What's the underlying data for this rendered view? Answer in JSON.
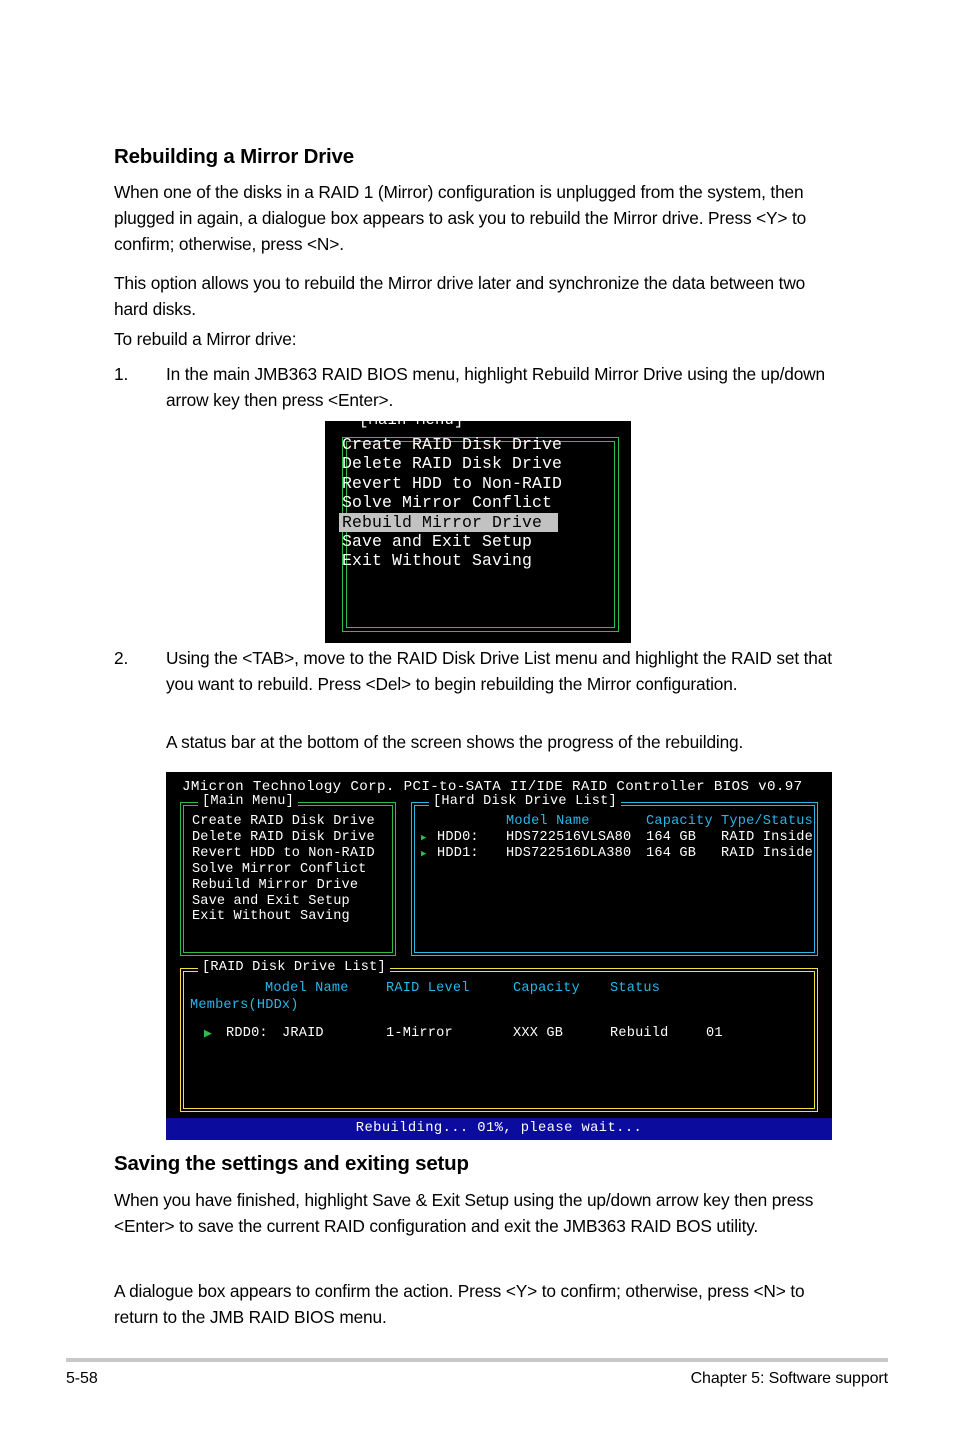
{
  "sections": {
    "heading1": "Rebuilding a Mirror Drive",
    "para1": "When one of the disks in a RAID 1 (Mirror) configuration is unplugged from the system, then plugged in again, a dialogue box appears to ask you to rebuild the Mirror drive. Press <Y> to confirm; otherwise, press <N>.",
    "para2": "This option allows you to rebuild the Mirror drive later and synchronize the data between two hard disks.",
    "para3": "To rebuild a Mirror drive:",
    "step1_num": "1.",
    "step1_text": "In the main JMB363 RAID BIOS menu, highlight Rebuild Mirror Drive using the up/down arrow key then press <Enter>.",
    "step2_num": "2.",
    "step2_text": "Using the <TAB>, move to the RAID Disk Drive List menu and highlight the RAID set that you want to rebuild. Press <Del> to begin rebuilding the Mirror configuration.",
    "step2_note": "A status bar at the bottom of the screen shows the progress of the rebuilding.",
    "heading2": "Saving the settings and exiting setup",
    "para4": "When you have finished, highlight Save & Exit Setup using the up/down arrow key then press <Enter> to save the current RAID configuration and exit the JMB363 RAID BOS utility.",
    "para5": "A dialogue box appears to confirm the action. Press <Y> to confirm; otherwise, press <N> to return to the JMB RAID BIOS menu."
  },
  "bios_menu_screen": {
    "title": "[Main Menu]",
    "items": [
      "Create RAID Disk Drive",
      "Delete RAID Disk Drive",
      "Revert HDD to Non-RAID",
      "Solve Mirror Conflict",
      "Rebuild Mirror Drive",
      "Save and Exit Setup",
      "Exit Without Saving"
    ],
    "selected_index": 4
  },
  "bios_full_screen": {
    "title_bar": "JMicron Technology Corp. PCI-to-SATA II/IDE RAID Controller BIOS v0.97",
    "main_menu": {
      "title": "[Main Menu]",
      "items": [
        "Create RAID Disk Drive",
        "Delete RAID Disk Drive",
        "Revert HDD to Non-RAID",
        "Solve Mirror Conflict",
        "Rebuild Mirror Drive",
        "Save and Exit Setup",
        "Exit Without Saving"
      ]
    },
    "hard_disk_drive_list": {
      "title": "[Hard Disk Drive List]",
      "columns": [
        "Model Name",
        "Capacity",
        "Type/Status"
      ],
      "rows": [
        {
          "id": "HDD0:",
          "model": "HDS722516VLSA80",
          "capacity": "164 GB",
          "type_status": "RAID Inside"
        },
        {
          "id": "HDD1:",
          "model": "HDS722516DLA380",
          "capacity": "164 GB",
          "type_status": "RAID Inside"
        }
      ]
    },
    "raid_disk_drive_list": {
      "title": "[RAID Disk Drive List]",
      "columns": [
        "Model Name",
        "RAID Level",
        "Capacity",
        "Status"
      ],
      "members_label": "Members(HDDx)",
      "rows": [
        {
          "id": "RDD0:",
          "model": "JRAID",
          "raid_level": "1-Mirror",
          "capacity": "XXX GB",
          "status": "Rebuild",
          "members": "01"
        }
      ]
    },
    "status_bar": "Rebuilding... 01%, please wait..."
  },
  "footer": {
    "page_number": "5-58",
    "chapter": "Chapter 5: Software support"
  },
  "colors": {
    "green_border": "#2fbc4e",
    "cyan_border": "#29b6e8",
    "yellow_border": "#f3e03a",
    "status_bar_bg": "#0b0b9e",
    "highlight_bg": "#c2c2c2",
    "screen_bg": "#000000"
  }
}
